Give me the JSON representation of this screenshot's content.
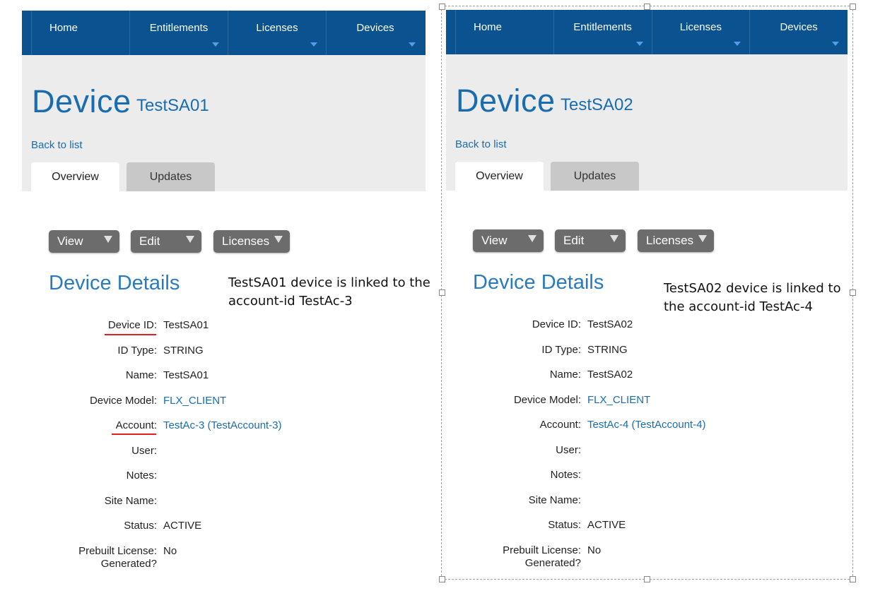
{
  "nav": [
    "Home",
    "Entitlements",
    "Licenses",
    "Devices"
  ],
  "panels": [
    {
      "page_heading": "Device",
      "device_id": "TestSA01",
      "back_link": "Back to list",
      "tabs": [
        "Overview",
        "Updates"
      ],
      "buttons": [
        "View",
        "Edit",
        "Licenses"
      ],
      "section_title": "Device Details",
      "annotation": "TestSA01 device is linked to the account-id TestAc-3",
      "fields": [
        {
          "label": "Device ID:",
          "value": "TestSA01"
        },
        {
          "label": "ID Type:",
          "value": "STRING"
        },
        {
          "label": "Name:",
          "value": "TestSA01"
        },
        {
          "label": "Device Model:",
          "value": "FLX_CLIENT"
        },
        {
          "label": "Account:",
          "value": "TestAc-3 (TestAccount-3)"
        },
        {
          "label": "User:",
          "value": ""
        },
        {
          "label": "Notes:",
          "value": ""
        },
        {
          "label": "Site Name:",
          "value": ""
        },
        {
          "label": "Status:",
          "value": "ACTIVE"
        },
        {
          "label": "Prebuilt License: Generated?",
          "value": "No"
        }
      ]
    },
    {
      "page_heading": "Device",
      "device_id": "TestSA02",
      "back_link": "Back to list",
      "tabs": [
        "Overview",
        "Updates"
      ],
      "buttons": [
        "View",
        "Edit",
        "Licenses"
      ],
      "section_title": "Device Details",
      "annotation": "TestSA02 device is linked to the account-id TestAc-4",
      "fields": [
        {
          "label": "Device ID:",
          "value": "TestSA02"
        },
        {
          "label": "ID Type:",
          "value": "STRING"
        },
        {
          "label": "Name:",
          "value": "TestSA02"
        },
        {
          "label": "Device Model:",
          "value": "FLX_CLIENT"
        },
        {
          "label": "Account:",
          "value": "TestAc-4 (TestAccount-4)"
        },
        {
          "label": "User:",
          "value": ""
        },
        {
          "label": "Notes:",
          "value": ""
        },
        {
          "label": "Site Name:",
          "value": ""
        },
        {
          "label": "Status:",
          "value": "ACTIVE"
        },
        {
          "label": "Prebuilt License: Generated?",
          "value": "No"
        }
      ]
    }
  ],
  "colors": {
    "nav_bg": "#0b5390",
    "link": "#1a6cb0",
    "header_bg": "#ececec",
    "button": "#6c6c6c",
    "underline_annotation": "#e02020"
  }
}
